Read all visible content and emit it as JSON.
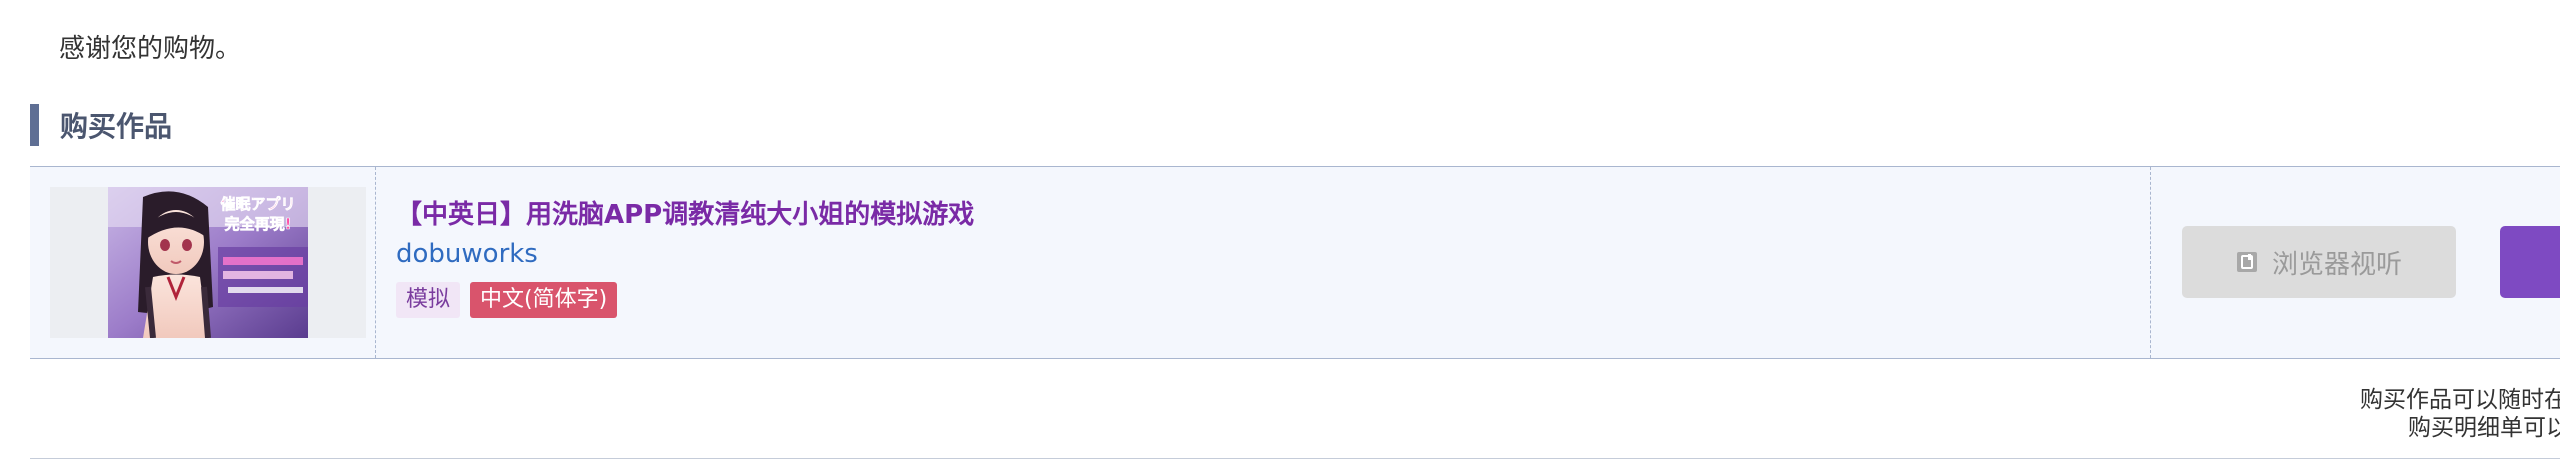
{
  "thanks_text": "感谢您的购物。",
  "section": {
    "title": "购买作品"
  },
  "item": {
    "title": "【中英日】用洗脑APP调教清纯大小姐的模拟游戏",
    "maker": "dobuworks",
    "tags": [
      "模拟",
      "中文(简体字)"
    ],
    "thumb_text_1": "催眠アプリ",
    "thumb_text_2": "完全再現!",
    "browser_button": {
      "label": "浏览器视听",
      "icon": "doc-icon"
    }
  },
  "notes": {
    "line1": "购买作品可以随时在",
    "line2": "购买明细单可以"
  },
  "colors": {
    "accent_bar": "#5f6f94",
    "title": "#7a2aa6",
    "maker_link": "#2f6bc0",
    "lang_tag": "#d9546c",
    "purple_button": "#7e4ac2"
  }
}
